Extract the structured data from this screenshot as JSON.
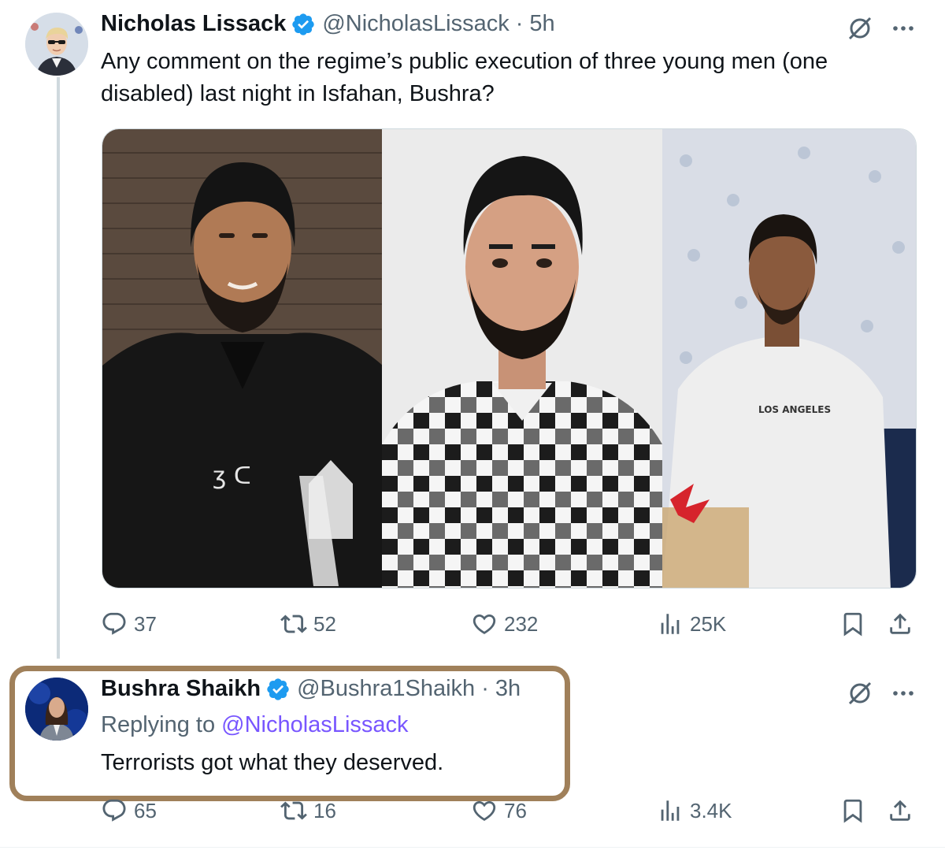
{
  "tweet": {
    "author_name": "Nicholas Lissack",
    "author_handle": "@NicholasLissack",
    "separator": "·",
    "time": "5h",
    "text": "Any comment on the regime’s public execution of three young men (one disabled) last night in Isfahan, Bushra?",
    "media_sweatshirt_text": "LOS ANGELES",
    "stats": {
      "replies": "37",
      "reposts": "52",
      "likes": "232",
      "views": "25K"
    }
  },
  "reply": {
    "author_name": "Bushra Shaikh",
    "author_handle": "@Bushra1Shaikh",
    "separator": "·",
    "time": "3h",
    "replying_to_label": "Replying to",
    "replying_to_handle": "@NicholasLissack",
    "text": "Terrorists got what they deserved.",
    "stats": {
      "replies": "65",
      "reposts": "16",
      "likes": "76",
      "views": "3.4K"
    }
  },
  "colors": {
    "verified": "#1d9bf0",
    "mention": "#7856ff",
    "muted_text": "#536471",
    "highlight_border": "#a0805a"
  },
  "icons": [
    "verified-badge-icon",
    "grok-icon",
    "more-icon",
    "reply-icon",
    "repost-icon",
    "like-icon",
    "views-icon",
    "bookmark-icon",
    "share-icon"
  ]
}
